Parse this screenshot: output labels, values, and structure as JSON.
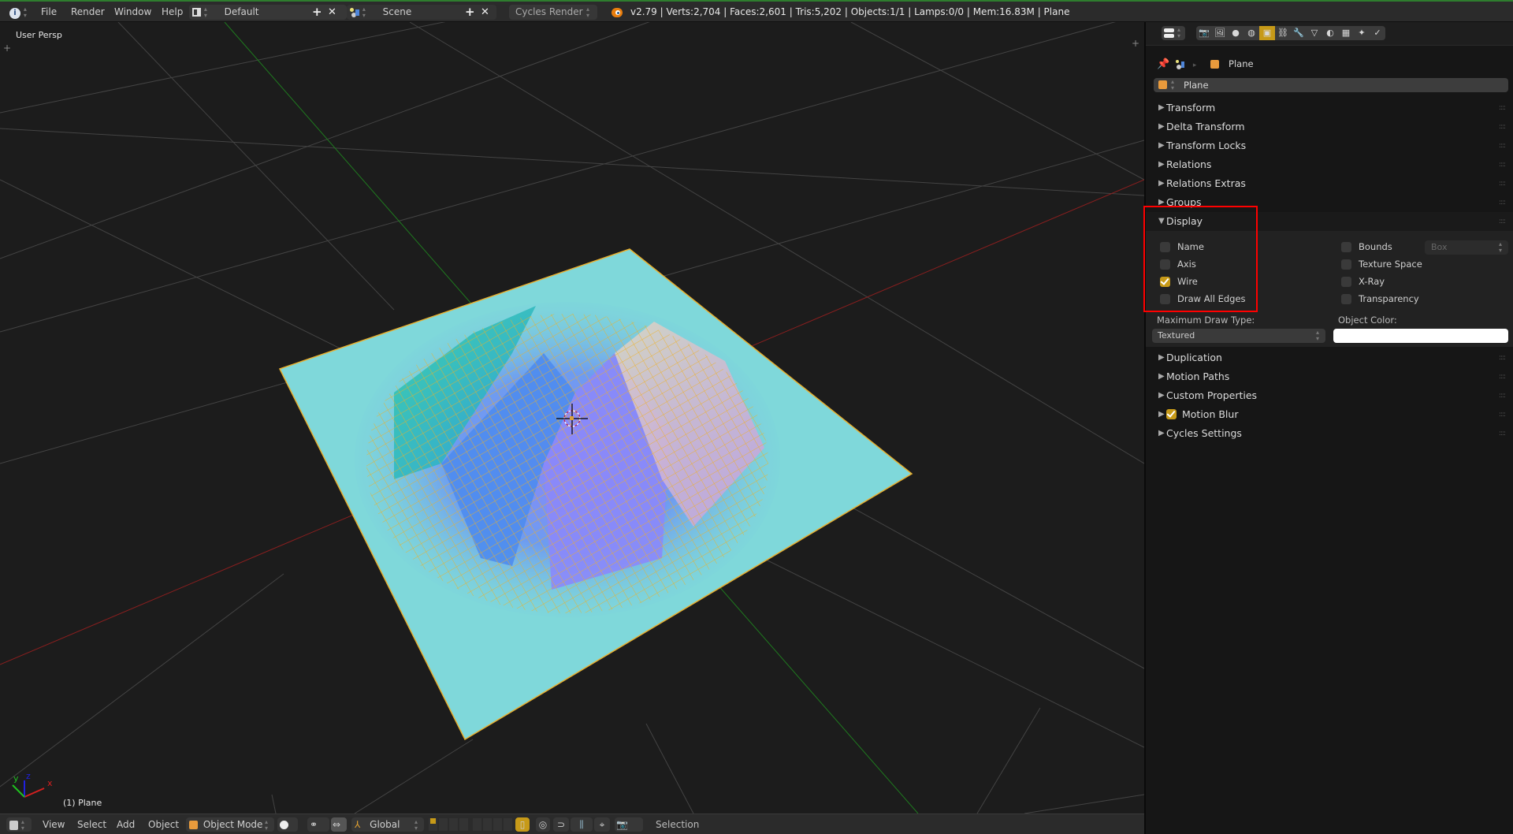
{
  "topbar": {
    "menus": [
      "File",
      "Render",
      "Window",
      "Help"
    ],
    "screen_layout": "Default",
    "scene": "Scene",
    "render_engine": "Cycles Render",
    "stats": "v2.79 | Verts:2,704 | Faces:2,601 | Tris:5,202 | Objects:1/1 | Lamps:0/0 | Mem:16.83M | Plane",
    "icons": [
      "info-icon",
      "screen-layout-icon",
      "add-icon",
      "close-icon",
      "scene-icon",
      "blender-logo-icon"
    ]
  },
  "viewport": {
    "view_label": "User Persp",
    "object_label": "(1) Plane",
    "axis_labels": {
      "x": "x",
      "y": "y",
      "z": "z"
    },
    "colors": {
      "background": "#1c1c1c",
      "grid": "#3d3d3d",
      "x_axis": "#8a1f1f",
      "y_axis": "#1f7a1f",
      "plane": "#7fd8da",
      "wire": "#f0b020"
    }
  },
  "bottombar": {
    "menus": [
      "View",
      "Select",
      "Add",
      "Object"
    ],
    "mode": "Object Mode",
    "orientation": "Global",
    "status": "Selection"
  },
  "properties": {
    "context_tabs": [
      "render",
      "render-layers",
      "scene",
      "world",
      "object",
      "constraints",
      "modifiers",
      "data",
      "material",
      "texture",
      "particles",
      "physics"
    ],
    "active_tab": "object",
    "breadcrumb": "Plane",
    "object_name": "Plane",
    "panels_before": [
      "Transform",
      "Delta Transform",
      "Transform Locks",
      "Relations",
      "Relations Extras",
      "Groups"
    ],
    "display_panel": {
      "title": "Display",
      "expanded": true,
      "left_options": [
        {
          "label": "Name",
          "checked": false
        },
        {
          "label": "Axis",
          "checked": false
        },
        {
          "label": "Wire",
          "checked": true
        },
        {
          "label": "Draw All Edges",
          "checked": false
        }
      ],
      "right_options": [
        {
          "label": "Bounds",
          "checked": false
        },
        {
          "label": "Texture Space",
          "checked": false
        },
        {
          "label": "X-Ray",
          "checked": false
        },
        {
          "label": "Transparency",
          "checked": false
        }
      ],
      "bounds_type": "Box",
      "max_draw_type_label": "Maximum Draw Type:",
      "max_draw_type": "Textured",
      "object_color_label": "Object Color:",
      "object_color": "#ffffff"
    },
    "panels_after": [
      {
        "label": "Duplication",
        "checkbox": null
      },
      {
        "label": "Motion Paths",
        "checkbox": null
      },
      {
        "label": "Custom Properties",
        "checkbox": null
      },
      {
        "label": "Motion Blur",
        "checkbox": true
      },
      {
        "label": "Cycles Settings",
        "checkbox": null
      }
    ],
    "accent_color": "#c79a18",
    "highlight_box_color": "#ff0000"
  }
}
